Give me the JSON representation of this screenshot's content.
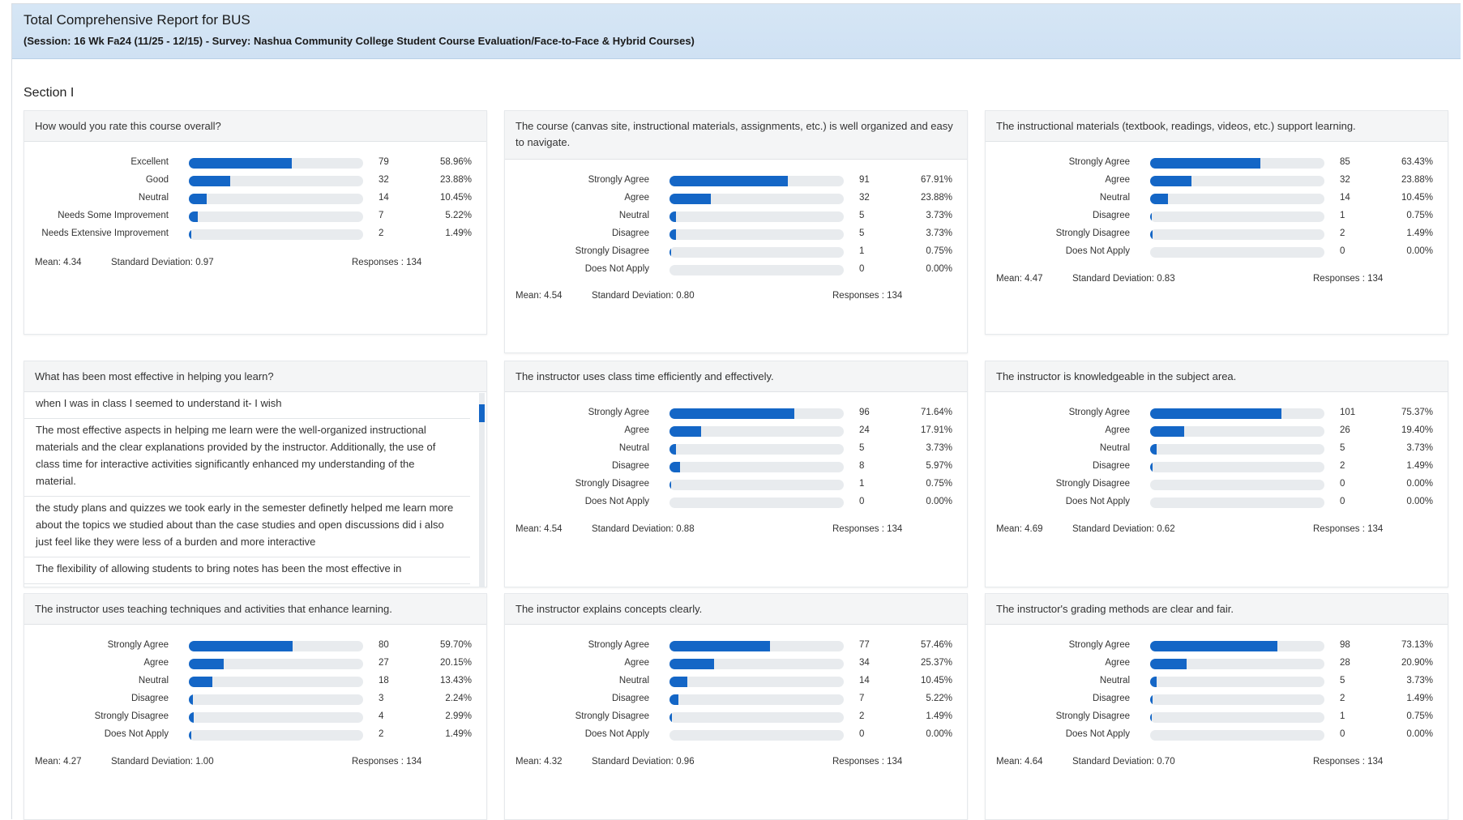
{
  "header": {
    "title": "Total Comprehensive Report for BUS",
    "subtitle": "(Session: 16 Wk Fa24 (11/25 - 12/15) - Survey: Nashua Community College Student Course Evaluation/Face-to-Face & Hybrid Courses)"
  },
  "section": {
    "title": "Section I"
  },
  "colors": {
    "accent": "#1466c6",
    "track": "#e8ebee",
    "header_bg": "#d6e6f5"
  },
  "cards": [
    {
      "question": "How would you rate this course overall?",
      "rows": [
        {
          "label": "Excellent",
          "count": "79",
          "pct": "58.96%",
          "fraction": 0.5896
        },
        {
          "label": "Good",
          "count": "32",
          "pct": "23.88%",
          "fraction": 0.2388
        },
        {
          "label": "Neutral",
          "count": "14",
          "pct": "10.45%",
          "fraction": 0.1045
        },
        {
          "label": "Needs Some Improvement",
          "count": "7",
          "pct": "5.22%",
          "fraction": 0.0522
        },
        {
          "label": "Needs Extensive Improvement",
          "count": "2",
          "pct": "1.49%",
          "fraction": 0.0149
        }
      ],
      "mean": "Mean: 4.34",
      "sd": "Standard Deviation: 0.97",
      "responses": "Responses : 134"
    },
    {
      "question": "The course (canvas site, instructional materials, assignments, etc.) is well organized and easy to navigate.",
      "rows": [
        {
          "label": "Strongly Agree",
          "count": "91",
          "pct": "67.91%",
          "fraction": 0.6791
        },
        {
          "label": "Agree",
          "count": "32",
          "pct": "23.88%",
          "fraction": 0.2388
        },
        {
          "label": "Neutral",
          "count": "5",
          "pct": "3.73%",
          "fraction": 0.0373
        },
        {
          "label": "Disagree",
          "count": "5",
          "pct": "3.73%",
          "fraction": 0.0373
        },
        {
          "label": "Strongly Disagree",
          "count": "1",
          "pct": "0.75%",
          "fraction": 0.0075
        },
        {
          "label": "Does Not Apply",
          "count": "0",
          "pct": "0.00%",
          "fraction": 0
        }
      ],
      "mean": "Mean: 4.54",
      "sd": "Standard Deviation: 0.80",
      "responses": "Responses : 134"
    },
    {
      "question": "The instructional materials (textbook, readings, videos, etc.) support learning.",
      "rows": [
        {
          "label": "Strongly Agree",
          "count": "85",
          "pct": "63.43%",
          "fraction": 0.6343
        },
        {
          "label": "Agree",
          "count": "32",
          "pct": "23.88%",
          "fraction": 0.2388
        },
        {
          "label": "Neutral",
          "count": "14",
          "pct": "10.45%",
          "fraction": 0.1045
        },
        {
          "label": "Disagree",
          "count": "1",
          "pct": "0.75%",
          "fraction": 0.0075
        },
        {
          "label": "Strongly Disagree",
          "count": "2",
          "pct": "1.49%",
          "fraction": 0.0149
        },
        {
          "label": "Does Not Apply",
          "count": "0",
          "pct": "0.00%",
          "fraction": 0
        }
      ],
      "mean": "Mean: 4.47",
      "sd": "Standard Deviation: 0.83",
      "responses": "Responses : 134"
    },
    {
      "question": "What has been most effective in helping you learn?",
      "comments": [
        "when I was in class I seemed to understand it- I wish",
        "The most effective aspects in helping me learn were the well-organized instructional materials and the clear explanations provided by the instructor. Additionally, the use of class time for interactive activities significantly enhanced my understanding of the material.",
        "the study plans and quizzes we took early in the semester definetly helped me learn more about the topics we studied about than the case studies and open discussions did i also just feel like they were less of a burden and more interactive",
        "The flexibility of allowing students to bring notes has been the most effective in"
      ]
    },
    {
      "question": "The instructor uses class time efficiently and effectively.",
      "rows": [
        {
          "label": "Strongly Agree",
          "count": "96",
          "pct": "71.64%",
          "fraction": 0.7164
        },
        {
          "label": "Agree",
          "count": "24",
          "pct": "17.91%",
          "fraction": 0.1791
        },
        {
          "label": "Neutral",
          "count": "5",
          "pct": "3.73%",
          "fraction": 0.0373
        },
        {
          "label": "Disagree",
          "count": "8",
          "pct": "5.97%",
          "fraction": 0.0597
        },
        {
          "label": "Strongly Disagree",
          "count": "1",
          "pct": "0.75%",
          "fraction": 0.0075
        },
        {
          "label": "Does Not Apply",
          "count": "0",
          "pct": "0.00%",
          "fraction": 0
        }
      ],
      "mean": "Mean: 4.54",
      "sd": "Standard Deviation: 0.88",
      "responses": "Responses : 134"
    },
    {
      "question": "The instructor is knowledgeable in the subject area.",
      "rows": [
        {
          "label": "Strongly Agree",
          "count": "101",
          "pct": "75.37%",
          "fraction": 0.7537
        },
        {
          "label": "Agree",
          "count": "26",
          "pct": "19.40%",
          "fraction": 0.194
        },
        {
          "label": "Neutral",
          "count": "5",
          "pct": "3.73%",
          "fraction": 0.0373
        },
        {
          "label": "Disagree",
          "count": "2",
          "pct": "1.49%",
          "fraction": 0.0149
        },
        {
          "label": "Strongly Disagree",
          "count": "0",
          "pct": "0.00%",
          "fraction": 0
        },
        {
          "label": "Does Not Apply",
          "count": "0",
          "pct": "0.00%",
          "fraction": 0
        }
      ],
      "mean": "Mean: 4.69",
      "sd": "Standard Deviation: 0.62",
      "responses": "Responses : 134"
    },
    {
      "question": "The instructor uses teaching techniques and activities that enhance learning.",
      "rows": [
        {
          "label": "Strongly Agree",
          "count": "80",
          "pct": "59.70%",
          "fraction": 0.597
        },
        {
          "label": "Agree",
          "count": "27",
          "pct": "20.15%",
          "fraction": 0.2015
        },
        {
          "label": "Neutral",
          "count": "18",
          "pct": "13.43%",
          "fraction": 0.1343
        },
        {
          "label": "Disagree",
          "count": "3",
          "pct": "2.24%",
          "fraction": 0.0224
        },
        {
          "label": "Strongly Disagree",
          "count": "4",
          "pct": "2.99%",
          "fraction": 0.0299
        },
        {
          "label": "Does Not Apply",
          "count": "2",
          "pct": "1.49%",
          "fraction": 0.0149
        }
      ],
      "mean": "Mean: 4.27",
      "sd": "Standard Deviation: 1.00",
      "responses": "Responses : 134"
    },
    {
      "question": "The instructor explains concepts clearly.",
      "rows": [
        {
          "label": "Strongly Agree",
          "count": "77",
          "pct": "57.46%",
          "fraction": 0.5746
        },
        {
          "label": "Agree",
          "count": "34",
          "pct": "25.37%",
          "fraction": 0.2537
        },
        {
          "label": "Neutral",
          "count": "14",
          "pct": "10.45%",
          "fraction": 0.1045
        },
        {
          "label": "Disagree",
          "count": "7",
          "pct": "5.22%",
          "fraction": 0.0522
        },
        {
          "label": "Strongly Disagree",
          "count": "2",
          "pct": "1.49%",
          "fraction": 0.0149
        },
        {
          "label": "Does Not Apply",
          "count": "0",
          "pct": "0.00%",
          "fraction": 0
        }
      ],
      "mean": "Mean: 4.32",
      "sd": "Standard Deviation: 0.96",
      "responses": "Responses : 134"
    },
    {
      "question": "The instructor's grading methods are clear and fair.",
      "rows": [
        {
          "label": "Strongly Agree",
          "count": "98",
          "pct": "73.13%",
          "fraction": 0.7313
        },
        {
          "label": "Agree",
          "count": "28",
          "pct": "20.90%",
          "fraction": 0.209
        },
        {
          "label": "Neutral",
          "count": "5",
          "pct": "3.73%",
          "fraction": 0.0373
        },
        {
          "label": "Disagree",
          "count": "2",
          "pct": "1.49%",
          "fraction": 0.0149
        },
        {
          "label": "Strongly Disagree",
          "count": "1",
          "pct": "0.75%",
          "fraction": 0.0075
        },
        {
          "label": "Does Not Apply",
          "count": "0",
          "pct": "0.00%",
          "fraction": 0
        }
      ],
      "mean": "Mean: 4.64",
      "sd": "Standard Deviation: 0.70",
      "responses": "Responses : 134"
    }
  ]
}
